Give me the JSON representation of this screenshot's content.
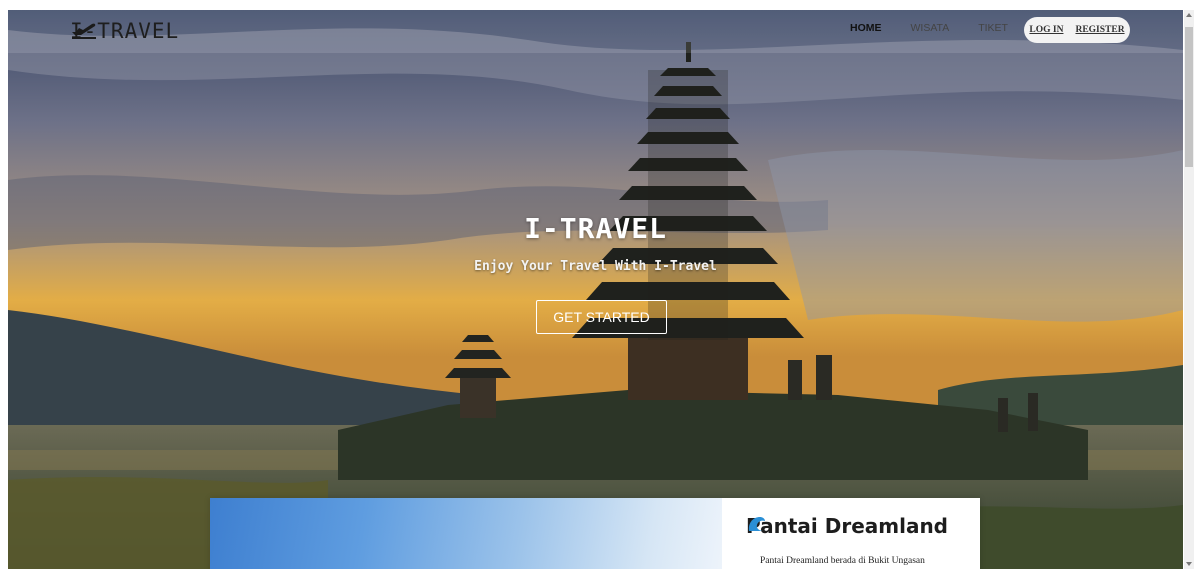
{
  "navbar": {
    "brand": "I-TRAVEL",
    "brand_icon": "plane-takeoff-icon",
    "links": [
      {
        "label": "HOME",
        "active": true
      },
      {
        "label": "WISATA",
        "active": false
      },
      {
        "label": "TIKET",
        "active": false
      }
    ],
    "auth": {
      "login": "LOG IN",
      "register": "REGISTER"
    }
  },
  "hero": {
    "title": "I-TRAVEL",
    "subtitle": "Enjoy Your Travel With I-Travel",
    "cta_label": "GET STARTED"
  },
  "card": {
    "title": "Pantai Dreamland",
    "title_icon": "wave-icon",
    "description": "Pantai Dreamland berada di Bukit Ungasan"
  },
  "colors": {
    "accent": "#2a8fd6",
    "hero_overlay_text": "#ffffff"
  }
}
